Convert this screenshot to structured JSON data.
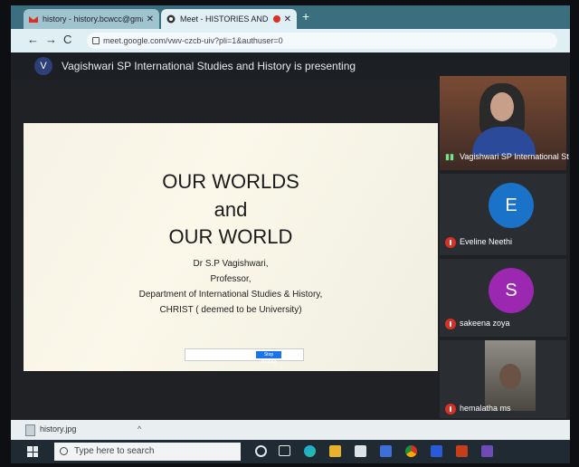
{
  "browser": {
    "tabs": [
      {
        "label": "history - history.bcwcc@gmail.cc"
      },
      {
        "label": "Meet - HISTORIES AND IDEN"
      }
    ],
    "new_tab_glyph": "+",
    "url": "meet.google.com/vwv-czcb-uiv?pli=1&authuser=0"
  },
  "meet": {
    "presenter_initial": "V",
    "presenting_text": "Vagishwari SP International Studies and History is presenting"
  },
  "slide": {
    "title_lines": [
      "OUR WORLDS",
      "and",
      "OUR WORLD"
    ],
    "author": "Dr S.P Vagishwari,",
    "role": "Professor,",
    "dept": "Department of International Studies & History,",
    "institution": "CHRIST ( deemed to be University)",
    "share_button": "Stop sharing"
  },
  "participants": [
    {
      "name": "Vagishwari SP International St"
    },
    {
      "name": "Eveline Neethi",
      "initial": "E",
      "color": "#1a73c8"
    },
    {
      "name": "sakeena zoya",
      "initial": "S",
      "color": "#9c27b0"
    },
    {
      "name": "hemalatha ms"
    }
  ],
  "downloads": {
    "file": "history.jpg",
    "chevron": "^"
  },
  "taskbar": {
    "search_placeholder": "Type here to search"
  }
}
